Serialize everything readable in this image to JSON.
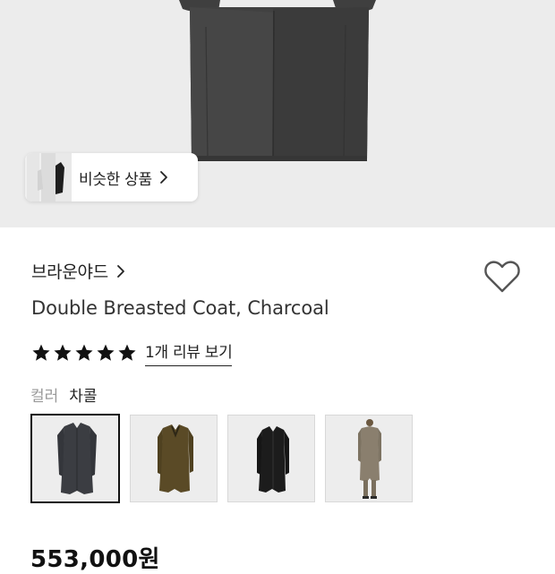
{
  "hero": {
    "image_alt": "charcoal double breasted coat",
    "similar_button": {
      "label": "비슷한 상품",
      "icon": "chevron-right-icon"
    }
  },
  "product": {
    "brand": "브라운야드",
    "brand_icon": "chevron-right-icon",
    "title": "Double Breasted Coat, Charcoal",
    "rating_stars": 5,
    "review_link": "1개 리뷰 보기",
    "color_label": "컬러",
    "color_value": "차콜",
    "price": "553,000원"
  },
  "swatches": [
    {
      "name": "charcoal",
      "color": "#3b3d42",
      "selected": true
    },
    {
      "name": "olive",
      "color": "#5a4a26",
      "selected": false
    },
    {
      "name": "black",
      "color": "#1c1c1c",
      "selected": false
    },
    {
      "name": "beige-model",
      "color": "#8a7f6e",
      "selected": false
    }
  ],
  "colors": {
    "hero_bg": "#ececec",
    "coat": "#3e3e3e",
    "star": "#111111"
  }
}
